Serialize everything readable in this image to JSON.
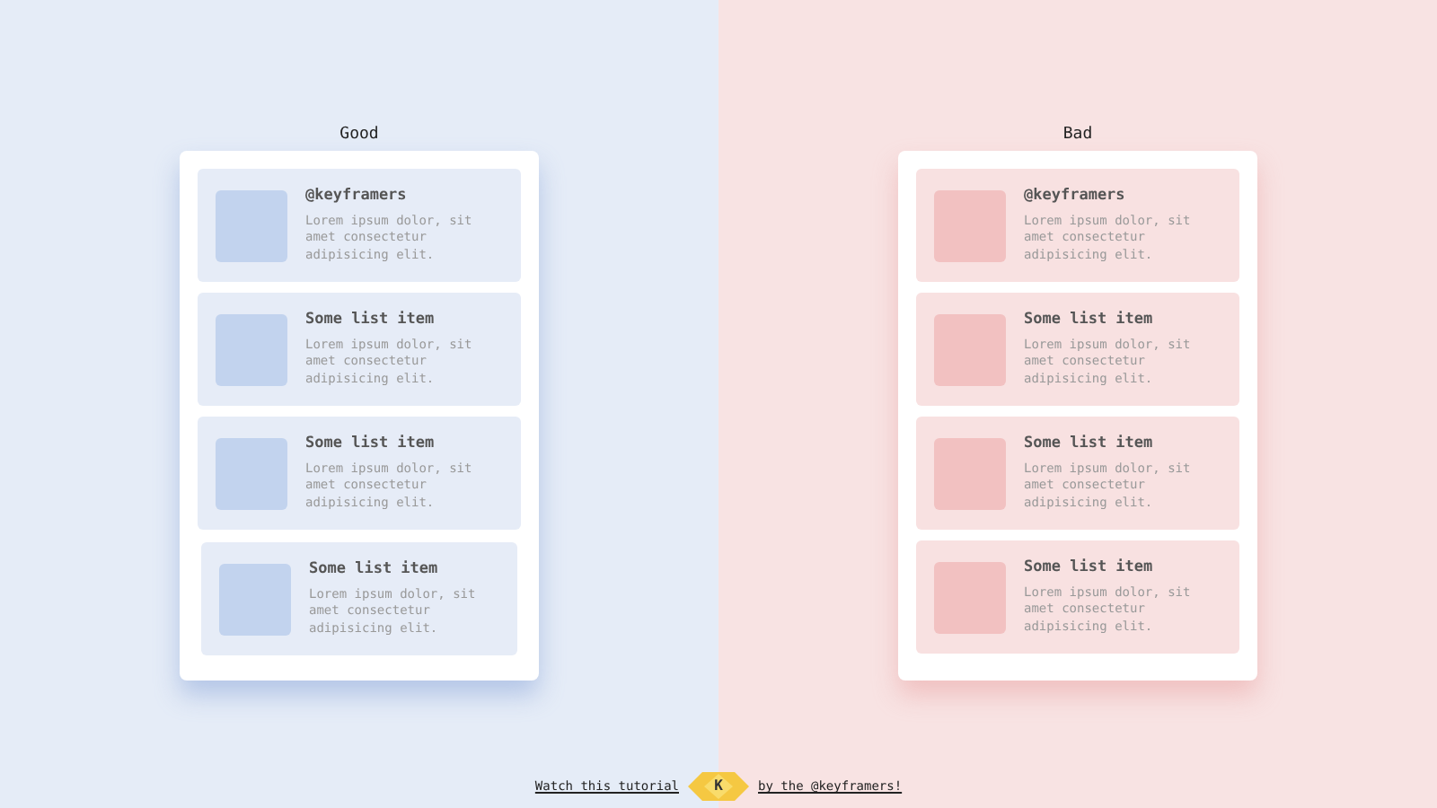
{
  "panels": [
    {
      "heading": "Good",
      "kind": "good",
      "items": [
        {
          "title": "@keyframers",
          "text": "Lorem ipsum dolor, sit amet consectetur adipisicing elit.",
          "hovered": false
        },
        {
          "title": "Some list item",
          "text": "Lorem ipsum dolor, sit amet consectetur adipisicing elit.",
          "hovered": false
        },
        {
          "title": "Some list item",
          "text": "Lorem ipsum dolor, sit amet consectetur adipisicing elit.",
          "hovered": false
        },
        {
          "title": "Some list item",
          "text": "Lorem ipsum dolor, sit amet consectetur adipisicing elit.",
          "hovered": true
        }
      ]
    },
    {
      "heading": "Bad",
      "kind": "bad",
      "items": [
        {
          "title": "@keyframers",
          "text": "Lorem ipsum dolor, sit amet consectetur adipisicing elit.",
          "hovered": false
        },
        {
          "title": "Some list item",
          "text": "Lorem ipsum dolor, sit amet consectetur adipisicing elit.",
          "hovered": false
        },
        {
          "title": "Some list item",
          "text": "Lorem ipsum dolor, sit amet consectetur adipisicing elit.",
          "hovered": false
        },
        {
          "title": "Some list item",
          "text": "Lorem ipsum dolor, sit amet consectetur adipisicing elit.",
          "hovered": false
        }
      ]
    }
  ],
  "footer": {
    "link_left": "Watch this tutorial",
    "logo_letter": "K",
    "link_right": "by the @keyframers!"
  }
}
